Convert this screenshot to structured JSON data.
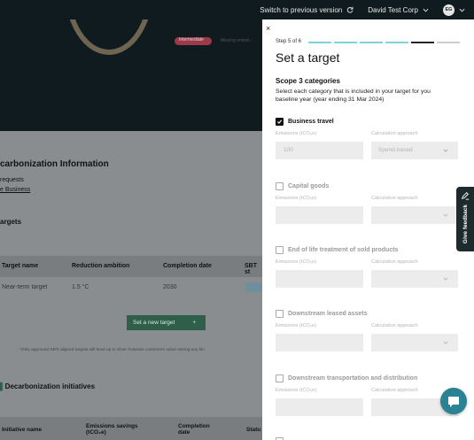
{
  "topbar": {
    "switch_label": "Switch to previous version",
    "org_name": "David Test Corp",
    "user_initials": "EG"
  },
  "background": {
    "status_pill": "Intermediate",
    "status_text": "Missing emissi...",
    "section_heading": "carbonization Information",
    "requests_text": "requests",
    "business_link": "e Business",
    "targets_heading": "argets",
    "table_headers": [
      "Target name",
      "Reduction ambition",
      "Completion date",
      "SBT st"
    ],
    "table_row": [
      "Near-term target",
      "1.5 °C",
      "2030"
    ],
    "new_target_label": "Set a new target",
    "new_target_icon": "+",
    "note": "*Only approved SBTi aligned targets will level up to silver however customers value seeing any kin",
    "initiatives_heading": "Decarbonization initiatives",
    "initiatives_headers": [
      "Initiative name",
      "Emissions savings (tCO₂e)",
      "Completion date",
      "Statu"
    ]
  },
  "panel": {
    "close_icon": "×",
    "step_label": "Step 5 of 6",
    "progress": {
      "total": 6,
      "current": 5
    },
    "title": "Set a target",
    "section_title": "Scope 3 categories",
    "section_desc": "Select each category that is included in your target for you baseline year (year ending 31 Mar 2024)",
    "emissions_label": "Emissions (tCO₂e)",
    "approach_label": "Calculation approach",
    "categories": [
      {
        "label": "Business travel",
        "checked": true,
        "emissions": "100",
        "approach": "Spend-based"
      },
      {
        "label": "Capital goods",
        "checked": false,
        "emissions": "",
        "approach": ""
      },
      {
        "label": "End of life treatment of sold products",
        "checked": false,
        "emissions": "",
        "approach": ""
      },
      {
        "label": "Downstream leased assets",
        "checked": false,
        "emissions": "",
        "approach": ""
      },
      {
        "label": "Downstream transportation and distribution",
        "checked": false,
        "emissions": "",
        "approach": ""
      }
    ]
  },
  "feedback": {
    "label": "Give feedback"
  },
  "colors": {
    "progress_done": "#7fd3dc",
    "progress_current": "#222222",
    "chat": "#2a8293",
    "topbar": "#0f1b1f"
  }
}
